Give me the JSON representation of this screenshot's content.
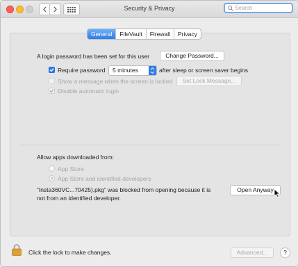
{
  "window": {
    "title": "Security & Privacy"
  },
  "search": {
    "placeholder": "Search"
  },
  "tabs": [
    {
      "label": "General",
      "active": true
    },
    {
      "label": "FileVault",
      "active": false
    },
    {
      "label": "Firewall",
      "active": false
    },
    {
      "label": "Privacy",
      "active": false
    }
  ],
  "general": {
    "login_text": "A login password has been set for this user",
    "change_password_label": "Change Password...",
    "require_password_label": "Require password",
    "require_password_value": "5 minutes",
    "after_sleep_text": "after sleep or screen saver begins",
    "show_message_label": "Show a message when the screen is locked",
    "set_lock_message_label": "Set Lock Message...",
    "disable_auto_login_label": "Disable automatic login"
  },
  "downloads": {
    "heading": "Allow apps downloaded from:",
    "option_app_store": "App Store",
    "option_identified": "App Store and identified developers",
    "blocked_line1": "“Insta360VC...70425).pkg” was blocked from opening because it is",
    "blocked_line2": "not from an identified developer.",
    "open_anyway_label": "Open Anyway"
  },
  "footer": {
    "lock_text": "Click the lock to make changes.",
    "advanced_label": "Advanced...",
    "help_label": "?"
  },
  "colors": {
    "accent": "#2f7bea",
    "close": "#fc5f57",
    "minimize": "#fdbc2e",
    "zoom_disabled": "#cfcfcf",
    "lock": "#e0a43a"
  }
}
